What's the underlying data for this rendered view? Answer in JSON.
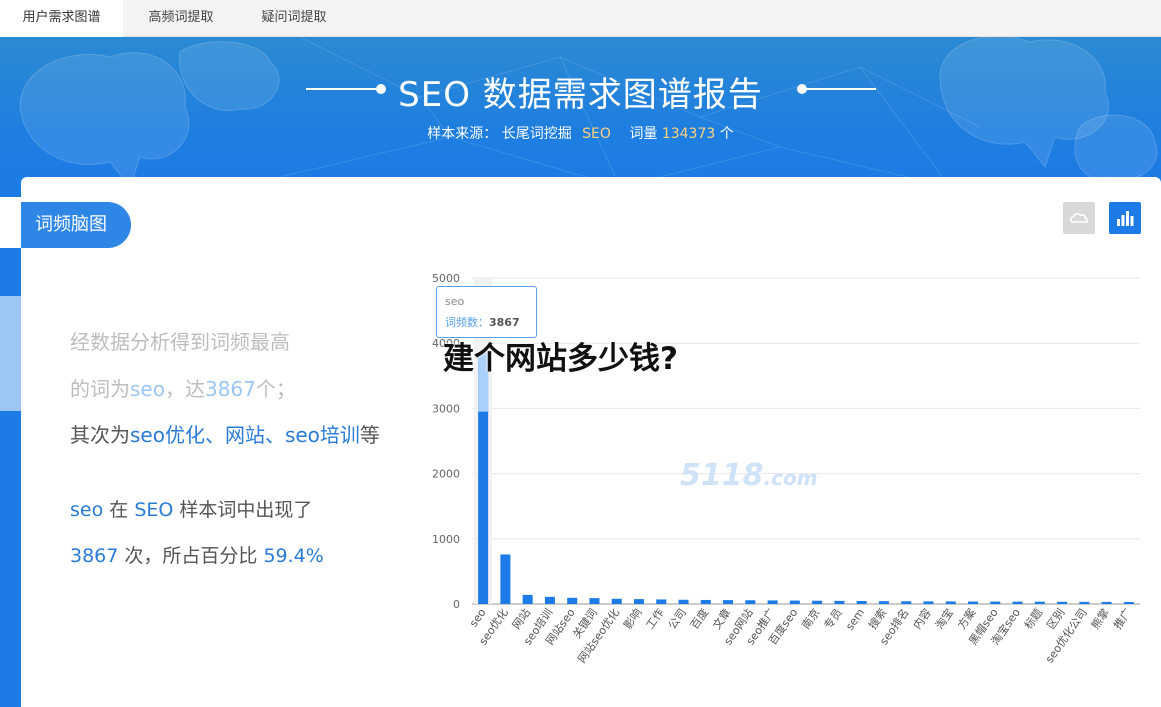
{
  "tabs": [
    {
      "label": "用户需求图谱",
      "active": true
    },
    {
      "label": "高频词提取",
      "active": false
    },
    {
      "label": "疑问词提取",
      "active": false
    }
  ],
  "banner": {
    "title": "SEO 数据需求图谱报告",
    "sub_prefix": "样本来源：  长尾词挖掘",
    "keyword": "SEO",
    "count_label": "词量",
    "count": "134373",
    "unit": "个"
  },
  "section": {
    "label": "词频脑图"
  },
  "summary": {
    "line1": "经数据分析得到词频最高",
    "line2_a": "的词为",
    "line2_word": "seo",
    "line2_b": "，达",
    "line2_num": "3867",
    "line2_c": "个；",
    "line3_a": "其次为",
    "line3_words": "seo优化、网站、seo培训",
    "line3_b": "等",
    "line4_word": "seo",
    "line4_a": "在",
    "line4_kw": "SEO",
    "line4_b": "样本词中出现了",
    "line5_num": "3867",
    "line5_a": "次，所占百分比",
    "line5_pct": "59.4%"
  },
  "tooltip": {
    "name": "seo",
    "label": "词频数：",
    "value": "3867"
  },
  "overlay": {
    "title": "建个网站多少钱?"
  },
  "watermark": {
    "main": "5118",
    "suffix": ".com"
  },
  "colors": {
    "accent": "#1c7be6",
    "highlight": "#ffd27a"
  },
  "chart_data": {
    "type": "bar",
    "categories": [
      "seo",
      "seo优化",
      "网站",
      "seo培训",
      "网站seo",
      "关键词",
      "网站seo优化",
      "影响",
      "工作",
      "公司",
      "百度",
      "文章",
      "seo网站",
      "seo推广",
      "百度seo",
      "南京",
      "专员",
      "sem",
      "搜索",
      "seo排名",
      "内容",
      "淘宝",
      "方案",
      "黑帽seo",
      "淘宝seo",
      "标题",
      "区别",
      "seo优化公司",
      "熊掌",
      "推广"
    ],
    "values": [
      3867,
      760,
      140,
      110,
      95,
      90,
      80,
      75,
      70,
      65,
      62,
      60,
      58,
      55,
      53,
      50,
      48,
      46,
      44,
      42,
      40,
      39,
      38,
      37,
      36,
      35,
      34,
      33,
      32,
      31
    ],
    "yticks": [
      0,
      1000,
      2000,
      3000,
      4000,
      5000
    ],
    "ylim": [
      0,
      5000
    ]
  }
}
